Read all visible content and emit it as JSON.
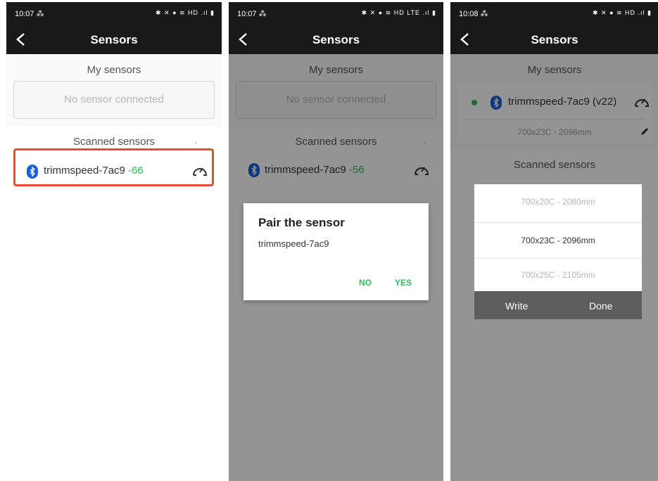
{
  "panel1": {
    "time": "10:07 ⁂",
    "status_icons": "✱ ✕ ● ≋ HD .ıl ▮",
    "title": "Sensors",
    "my_sensors_label": "My sensors",
    "no_sensor_text": "No sensor connected",
    "scanned_label": "Scanned sensors",
    "sensor_name": "trimmspeed-7ac9",
    "sensor_rssi": "-66"
  },
  "panel2": {
    "time": "10:07 ⁂",
    "status_icons": "✱ ✕ ● ≋ HD LTE .ıl ▮",
    "title": "Sensors",
    "my_sensors_label": "My sensors",
    "no_sensor_text": "No sensor connected",
    "scanned_label": "Scanned sensors",
    "sensor_name": "trimmspeed-7ac9",
    "sensor_rssi": "-56",
    "dialog": {
      "title": "Pair the sensor",
      "message": "trimmspeed-7ac9",
      "no_label": "NO",
      "yes_label": "YES"
    }
  },
  "panel3": {
    "time": "10:08 ⁂",
    "status_icons": "✱ ✕ ● ≋ HD .ıl ▮",
    "title": "Sensors",
    "my_sensors_label": "My sensors",
    "connected_sensor": "trimmspeed-7ac9 (v22)",
    "wheel_size": "700x23C - 2096mm",
    "scanned_label": "Scanned sensors",
    "picker_options": [
      "700x20C - 2080mm",
      "700x23C - 2096mm",
      "700x25C - 2105mm"
    ],
    "write_label": "Write",
    "done_label": "Done"
  },
  "colors": {
    "bar": "#191919",
    "rssi_green": "#2ebd5b",
    "bluetooth_blue": "#1a5fd6",
    "highlight_orange": "#e2522a"
  }
}
